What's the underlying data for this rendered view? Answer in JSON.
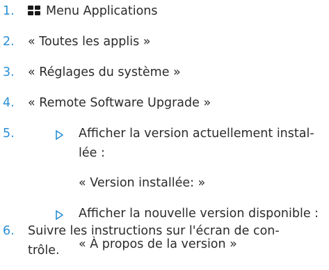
{
  "steps": [
    {
      "num": "1.",
      "text": "Menu Applications",
      "icon": "apps-grid-icon"
    },
    {
      "num": "2.",
      "text": "« Toutes les applis »"
    },
    {
      "num": "3.",
      "text": "« Réglages du système »"
    },
    {
      "num": "4.",
      "text": "« Remote Software Upgrade »"
    },
    {
      "num": "5.",
      "bullet1_line1": "Afficher la version actuellement instal-",
      "bullet1_line2": "lée :",
      "bullet1_sub": "« Version installée: »",
      "bullet2_line1": "Afficher la nouvelle version disponible :",
      "bullet2_sub": "« À propos de la version »"
    },
    {
      "num": "6.",
      "line1": "Suivre les instructions sur l'écran de con-",
      "line2": "trôle."
    }
  ],
  "colors": {
    "number": "#2a8fd6",
    "bullet": "#2a8fd6",
    "text": "#2b2b2b"
  }
}
